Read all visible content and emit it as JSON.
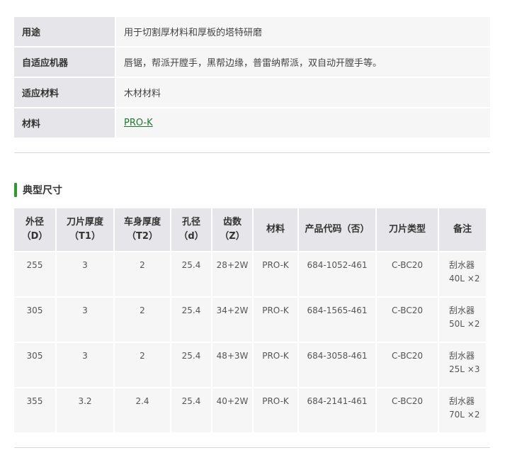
{
  "spec": {
    "rows": [
      {
        "key": "用途",
        "value": "用于切割厚材料和厚板的塔特研磨"
      },
      {
        "key": "自适应机器",
        "value": "唇锯，帮派开膛手，黑帮边缘，普雷纳帮派，双自动开膛手等。"
      },
      {
        "key": "适应材料",
        "value": "木材材料"
      },
      {
        "key": "材料",
        "value": "PRO-K"
      }
    ]
  },
  "section": {
    "title": "典型尺寸"
  },
  "dims": {
    "headers": [
      {
        "line1": "外径",
        "line2": "（D）"
      },
      {
        "line1": "刀片厚度",
        "line2": "（T1）"
      },
      {
        "line1": "车身厚度",
        "line2": "（T2）"
      },
      {
        "line1": "孔径",
        "line2": "（d）"
      },
      {
        "line1": "齿数",
        "line2": "（Z）"
      },
      {
        "line1": "材料",
        "line2": ""
      },
      {
        "line1": "产品代码（否）",
        "line2": ""
      },
      {
        "line1": "刀片类型",
        "line2": ""
      },
      {
        "line1": "备注",
        "line2": ""
      }
    ],
    "rows": [
      {
        "d": "255",
        "t1": "3",
        "t2": "2",
        "bore": "25.4",
        "z": "28+2W",
        "material": "PRO-K",
        "code": "684-1052-461",
        "type": "C-BC20",
        "note1": "刮水器",
        "note2": "40L ×2"
      },
      {
        "d": "305",
        "t1": "3",
        "t2": "2",
        "bore": "25.4",
        "z": "34+2W",
        "material": "PRO-K",
        "code": "684-1565-461",
        "type": "C-BC20",
        "note1": "刮水器",
        "note2": "50L ×2"
      },
      {
        "d": "305",
        "t1": "3",
        "t2": "2",
        "bore": "25.4",
        "z": "48+3W",
        "material": "PRO-K",
        "code": "684-3058-461",
        "type": "C-BC20",
        "note1": "刮水器",
        "note2": "25L ×3"
      },
      {
        "d": "355",
        "t1": "3.2",
        "t2": "2.4",
        "bore": "25.4",
        "z": "40+2W",
        "material": "PRO-K",
        "code": "684-2141-461",
        "type": "C-BC20",
        "note1": "刮水器",
        "note2": "70L ×2"
      }
    ]
  },
  "colors": {
    "accent": "#2e9b2e",
    "link": "#1a7a2e",
    "header_bg": "#e6e6ea",
    "cell_bg": "#f6f6f6"
  }
}
